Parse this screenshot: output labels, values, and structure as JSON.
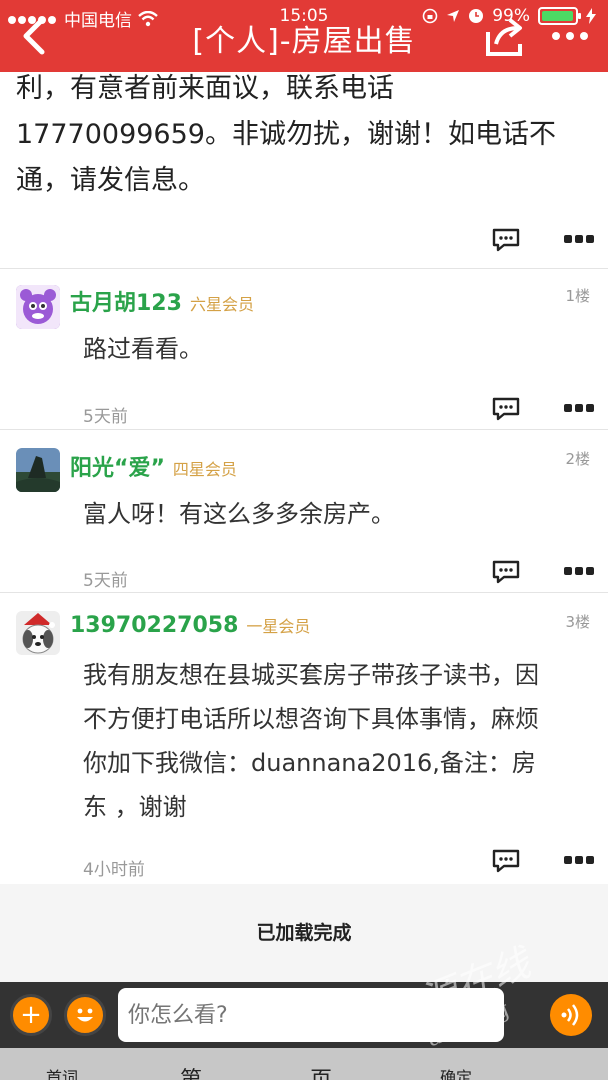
{
  "status_bar": {
    "carrier": "中国电信",
    "time": "15:05",
    "battery": "99%",
    "battery_level": 0.99
  },
  "nav": {
    "title": "[个人]-房屋出售",
    "icons": [
      "back-arrow-icon",
      "share-icon",
      "more-icon"
    ]
  },
  "post": {
    "lines": [
      "利，有意者前来面议，联系电话",
      "17770099659。非诚勿扰，谢谢！如电话不",
      "通，请发信息。"
    ]
  },
  "comments": [
    {
      "username": "古月胡123",
      "rank": "六星会员",
      "floor": "1楼",
      "text": "路过看看。",
      "time": "5天前"
    },
    {
      "username": "阳光“爱”",
      "rank": "四星会员",
      "floor": "2楼",
      "text": "富人呀！有这么多多余房产。",
      "time": "5天前"
    },
    {
      "username": "13970227058",
      "rank": "一星会员",
      "floor": "3楼",
      "text_lines": [
        "我有朋友想在县城买套房子带孩子读书，因",
        "不方便打电话所以想咨询下具体事情，麻烦",
        "你加下我微信：duannana2016,备注：房",
        "东 ，谢谢"
      ],
      "time": "4小时前"
    }
  ],
  "load_status": "已加载完成",
  "bottom_bar": {
    "placeholder": "你怎么看?",
    "add_symbol": "+"
  },
  "keyboard_hints": [
    "首词",
    "第",
    "页",
    "确定"
  ],
  "watermark": {
    "line1": "婺源在线",
    "line2": "ang.org"
  },
  "colors": {
    "header": "#e23a36",
    "username": "#2aa34a",
    "rank": "#d4a146",
    "accent_button": "#ff8c00"
  }
}
